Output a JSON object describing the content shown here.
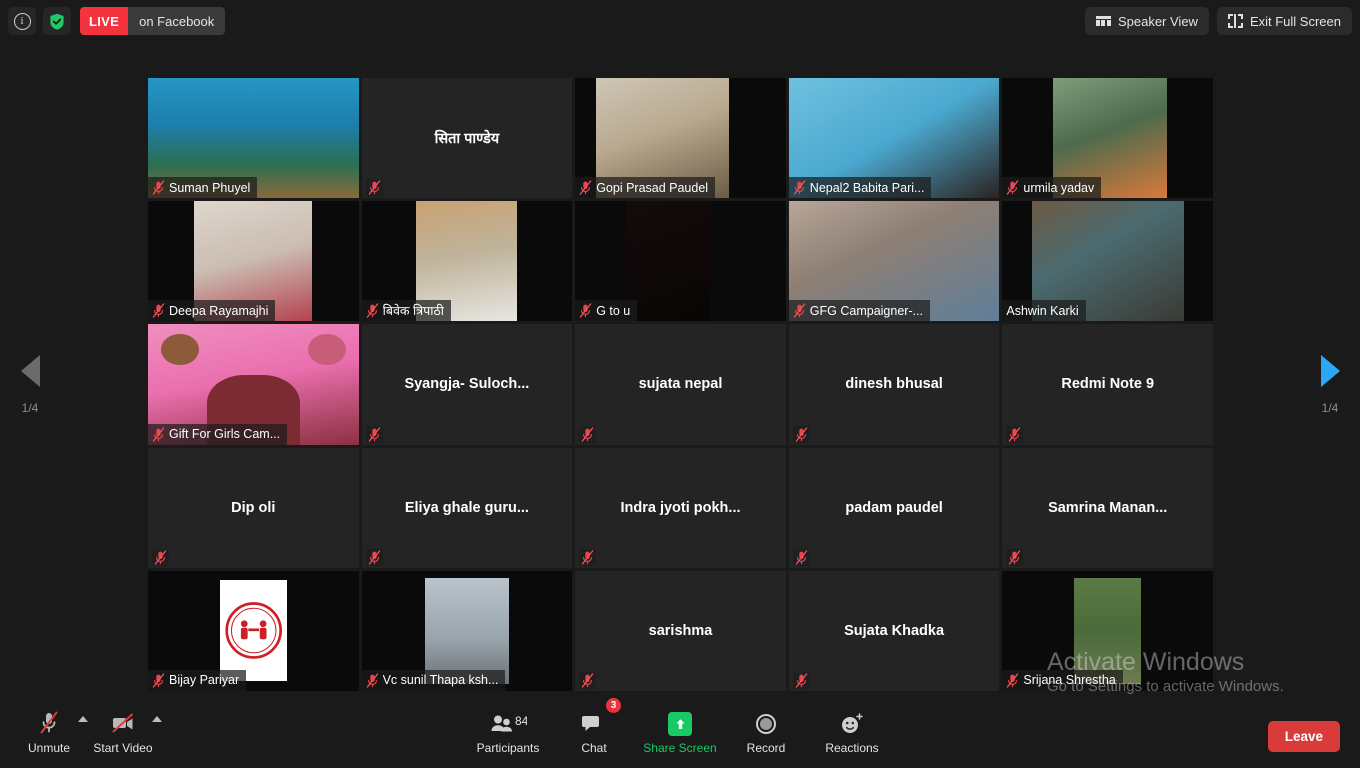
{
  "topbar": {
    "info_icon": "info-icon",
    "shield_icon": "encryption-shield-icon",
    "live_badge": "LIVE",
    "live_target": "on Facebook",
    "speaker_view": "Speaker View",
    "speaker_view_icon": "speaker-view-icon",
    "exit_full_screen": "Exit Full Screen",
    "exit_full_screen_icon": "exit-fullscreen-icon"
  },
  "pagination": {
    "prev_icon": "chevron-left-arrow",
    "next_icon": "chevron-right-arrow",
    "page_left": "1/4",
    "page_right": "1/4",
    "prev_color": "#6b6b6b",
    "next_color": "#2da7f5"
  },
  "grid": {
    "columns": 5,
    "rows": 5,
    "active_border_color": "#f2f240",
    "tiles": [
      {
        "name": "Suman Phuyel",
        "video": true,
        "muted": true,
        "active": false,
        "bg": "underwater",
        "label_bg": true
      },
      {
        "name": "सिता पाण्डेय",
        "video": false,
        "muted": true,
        "active": false,
        "bg": "none",
        "label_bg": false
      },
      {
        "name": "Gopi Prasad Paudel",
        "video": true,
        "muted": true,
        "active": false,
        "bg": "room",
        "label_bg": true
      },
      {
        "name": "Nepal2 Babita Pari...",
        "video": true,
        "muted": true,
        "active": false,
        "bg": "bluewall",
        "label_bg": true
      },
      {
        "name": "urmila yadav",
        "video": true,
        "muted": true,
        "active": false,
        "bg": "greenwall",
        "label_bg": true
      },
      {
        "name": "Deepa Rayamajhi",
        "video": true,
        "muted": true,
        "active": false,
        "bg": "pinkwall",
        "label_bg": true
      },
      {
        "name": "बिवेक त्रिपाठी",
        "video": true,
        "muted": true,
        "active": false,
        "bg": "tanwall",
        "label_bg": true
      },
      {
        "name": "G to u",
        "video": true,
        "muted": true,
        "active": false,
        "bg": "dark",
        "label_bg": true
      },
      {
        "name": "GFG Campaigner-...",
        "video": true,
        "muted": true,
        "active": false,
        "bg": "bedroom",
        "label_bg": true
      },
      {
        "name": "Ashwin Karki",
        "video": true,
        "muted": false,
        "active": true,
        "bg": "bookshelf",
        "label_bg": true
      },
      {
        "name": "Gift For Girls Cam...",
        "video": true,
        "muted": true,
        "active": false,
        "bg": "poster",
        "label_bg": true
      },
      {
        "name": "Syangja-  Suloch...",
        "video": false,
        "muted": true,
        "active": false,
        "bg": "none",
        "label_bg": false
      },
      {
        "name": "sujata nepal",
        "video": false,
        "muted": true,
        "active": false,
        "bg": "none",
        "label_bg": false
      },
      {
        "name": "dinesh bhusal",
        "video": false,
        "muted": true,
        "active": false,
        "bg": "none",
        "label_bg": false
      },
      {
        "name": "Redmi Note 9",
        "video": false,
        "muted": true,
        "active": false,
        "bg": "none",
        "label_bg": false
      },
      {
        "name": "Dip oli",
        "video": false,
        "muted": true,
        "active": false,
        "bg": "none",
        "label_bg": false
      },
      {
        "name": "Eliya  ghale  guru...",
        "video": false,
        "muted": true,
        "active": false,
        "bg": "none",
        "label_bg": false
      },
      {
        "name": "Indra  jyoti  pokh...",
        "video": false,
        "muted": true,
        "active": false,
        "bg": "none",
        "label_bg": false
      },
      {
        "name": "padam paudel",
        "video": false,
        "muted": true,
        "active": false,
        "bg": "none",
        "label_bg": false
      },
      {
        "name": "Samrina  Manan...",
        "video": false,
        "muted": true,
        "active": false,
        "bg": "none",
        "label_bg": false
      },
      {
        "name": "Bijay Pariyar",
        "video": true,
        "muted": true,
        "active": false,
        "bg": "logo",
        "label_bg": true
      },
      {
        "name": "Vc sunil Thapa ksh...",
        "video": true,
        "muted": true,
        "active": false,
        "bg": "street",
        "label_bg": true
      },
      {
        "name": "sarishma",
        "video": false,
        "muted": true,
        "active": false,
        "bg": "none",
        "label_bg": false
      },
      {
        "name": "Sujata Khadka",
        "video": false,
        "muted": true,
        "active": false,
        "bg": "none",
        "label_bg": false
      },
      {
        "name": "Srijana Shrestha",
        "video": true,
        "muted": true,
        "active": false,
        "bg": "garden",
        "label_bg": true
      }
    ]
  },
  "watermark": {
    "line1": "Activate Windows",
    "line2": "Go to Settings to activate Windows."
  },
  "bottombar": {
    "unmute": {
      "label": "Unmute",
      "icon": "microphone-muted-icon"
    },
    "start_video": {
      "label": "Start Video",
      "icon": "camera-off-icon"
    },
    "participants": {
      "label": "Participants",
      "icon": "participants-icon",
      "count": "84"
    },
    "chat": {
      "label": "Chat",
      "icon": "chat-bubble-icon",
      "badge": "3"
    },
    "share_screen": {
      "label": "Share Screen",
      "icon": "share-screen-icon",
      "color": "#18c964"
    },
    "record": {
      "label": "Record",
      "icon": "record-icon"
    },
    "reactions": {
      "label": "Reactions",
      "icon": "reactions-smiley-icon"
    },
    "leave": {
      "label": "Leave",
      "color": "#d93b3b"
    }
  }
}
